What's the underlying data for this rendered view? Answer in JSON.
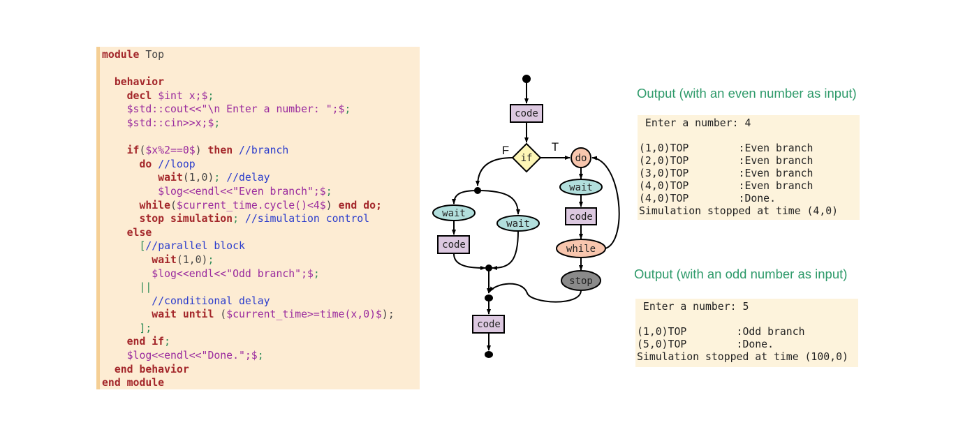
{
  "code_listing": [
    [
      [
        "kw",
        "module"
      ],
      [
        "plain",
        " Top"
      ]
    ],
    [],
    [
      [
        "plain",
        "  "
      ],
      [
        "kw",
        "behavior"
      ]
    ],
    [
      [
        "plain",
        "    "
      ],
      [
        "kw",
        "decl"
      ],
      [
        "str",
        " $int x;$"
      ],
      [
        "pun",
        ";"
      ]
    ],
    [
      [
        "plain",
        "    "
      ],
      [
        "str",
        "$std::cout<<\"\\n Enter a number: \";$"
      ],
      [
        "pun",
        ";"
      ]
    ],
    [
      [
        "plain",
        "    "
      ],
      [
        "str",
        "$std::cin>>x;$"
      ],
      [
        "pun",
        ";"
      ]
    ],
    [],
    [
      [
        "plain",
        "    "
      ],
      [
        "kw",
        "if"
      ],
      [
        "plain",
        "("
      ],
      [
        "str",
        "$x%2==0$"
      ],
      [
        "plain",
        ") "
      ],
      [
        "kw",
        "then"
      ],
      [
        "cm",
        " //branch"
      ]
    ],
    [
      [
        "plain",
        "      "
      ],
      [
        "kw",
        "do"
      ],
      [
        "cm",
        " //loop"
      ]
    ],
    [
      [
        "plain",
        "         "
      ],
      [
        "kw",
        "wait"
      ],
      [
        "plain",
        "(1,0)"
      ],
      [
        "pun",
        ";"
      ],
      [
        "cm",
        " //delay"
      ]
    ],
    [
      [
        "plain",
        "         "
      ],
      [
        "str",
        "$log<<endl<<\"Even branch\";$"
      ],
      [
        "pun",
        ";"
      ]
    ],
    [
      [
        "plain",
        "      "
      ],
      [
        "kw",
        "while"
      ],
      [
        "plain",
        "("
      ],
      [
        "str",
        "$current_time.cycle()<4$"
      ],
      [
        "plain",
        ") "
      ],
      [
        "kw",
        "end do;"
      ]
    ],
    [
      [
        "plain",
        "      "
      ],
      [
        "kw",
        "stop simulation"
      ],
      [
        "pun",
        ";"
      ],
      [
        "cm",
        " //simulation control"
      ]
    ],
    [
      [
        "plain",
        "    "
      ],
      [
        "kw",
        "else"
      ]
    ],
    [
      [
        "plain",
        "      "
      ],
      [
        "pun",
        "["
      ],
      [
        "cm",
        "//parallel block"
      ]
    ],
    [
      [
        "plain",
        "        "
      ],
      [
        "kw",
        "wait"
      ],
      [
        "plain",
        "(1,0)"
      ],
      [
        "pun",
        ";"
      ]
    ],
    [
      [
        "plain",
        "        "
      ],
      [
        "str",
        "$log<<endl<<\"Odd branch\";$"
      ],
      [
        "pun",
        ";"
      ]
    ],
    [
      [
        "plain",
        "      "
      ],
      [
        "pun",
        "||"
      ]
    ],
    [
      [
        "plain",
        "        "
      ],
      [
        "cm",
        "//conditional delay"
      ]
    ],
    [
      [
        "plain",
        "        "
      ],
      [
        "kw",
        "wait until"
      ],
      [
        "plain",
        " ("
      ],
      [
        "str",
        "$current_time>=time(x,0)$"
      ],
      [
        "plain",
        ");"
      ]
    ],
    [
      [
        "plain",
        "      "
      ],
      [
        "pun",
        "];"
      ]
    ],
    [
      [
        "plain",
        "    "
      ],
      [
        "kw",
        "end if"
      ],
      [
        "pun",
        ";"
      ]
    ],
    [
      [
        "plain",
        "    "
      ],
      [
        "str",
        "$log<<endl<<\"Done.\";$"
      ],
      [
        "pun",
        ";"
      ]
    ],
    [
      [
        "plain",
        "  "
      ],
      [
        "kw",
        "end behavior"
      ]
    ],
    [
      [
        "kw",
        "end module"
      ]
    ]
  ],
  "diagram": {
    "nodes": {
      "code_top": "code",
      "if": "if",
      "label_false": "F",
      "label_true": "T",
      "do": "do",
      "wait_right": "wait",
      "code_right": "code",
      "while": "while",
      "stop": "stop",
      "wait_left1": "wait",
      "wait_left2": "wait",
      "code_left": "code",
      "code_bottom": "code"
    },
    "colors": {
      "code": "#dcc8e0",
      "if": "#fdf6b6",
      "do_while": "#f8c6ae",
      "wait": "#b2dfdd",
      "stop": "#8a8a8a"
    }
  },
  "outputs": [
    {
      "title": "Output (with an even number as input)",
      "lines": [
        " Enter a number: 4",
        "",
        "(1,0)TOP        :Even branch",
        "(2,0)TOP        :Even branch",
        "(3,0)TOP        :Even branch",
        "(4,0)TOP        :Even branch",
        "(4,0)TOP        :Done.",
        "Simulation stopped at time (4,0)"
      ]
    },
    {
      "title": "Output (with an odd number as input)",
      "lines": [
        " Enter a number: 5",
        "",
        "(1,0)TOP        :Odd branch",
        "(5,0)TOP        :Done.",
        "Simulation stopped at time (100,0)"
      ]
    }
  ]
}
